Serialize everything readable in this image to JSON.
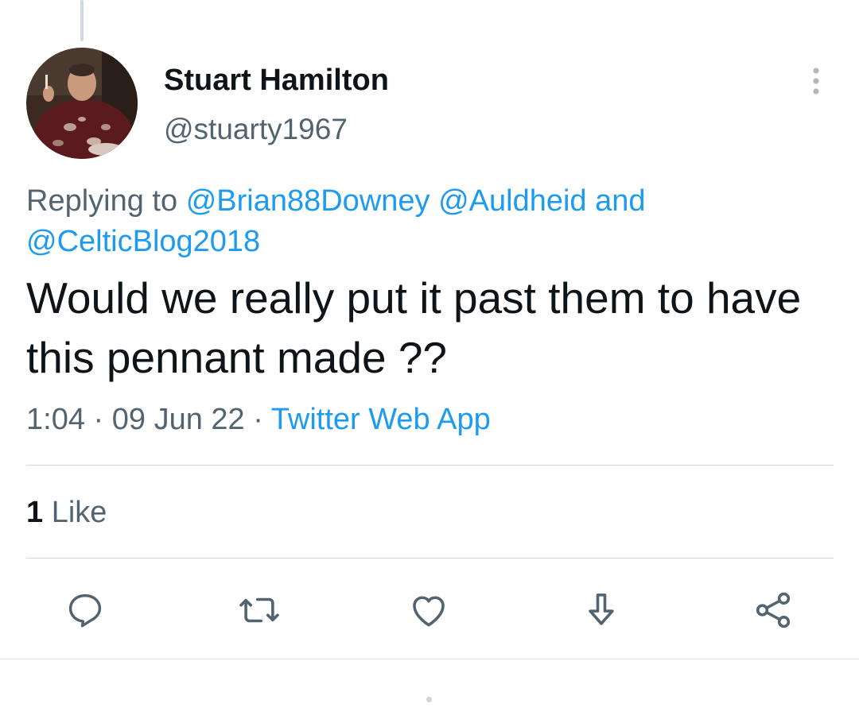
{
  "author": {
    "display_name": "Stuart Hamilton",
    "handle": "@stuarty1967"
  },
  "reply_context": {
    "prefix": "Replying to",
    "mentions": [
      "@Brian88Downey",
      "@Auldheid"
    ],
    "conjunction": "and",
    "last_mention": "@CelticBlog2018"
  },
  "tweet": {
    "text": "Would we really put it past them to have this pennant made ??",
    "time": "1:04",
    "date": "09 Jun 22",
    "separator": "·",
    "source": "Twitter Web App"
  },
  "stats": {
    "like_count": "1",
    "like_label": "Like"
  },
  "actions": {
    "icons": [
      "reply-icon",
      "retweet-icon",
      "like-icon",
      "download-icon",
      "share-icon"
    ]
  },
  "colors": {
    "link": "#1d9bf0",
    "secondary_text": "#536471",
    "primary_text": "#0f1419",
    "divider": "#cfd9de"
  }
}
